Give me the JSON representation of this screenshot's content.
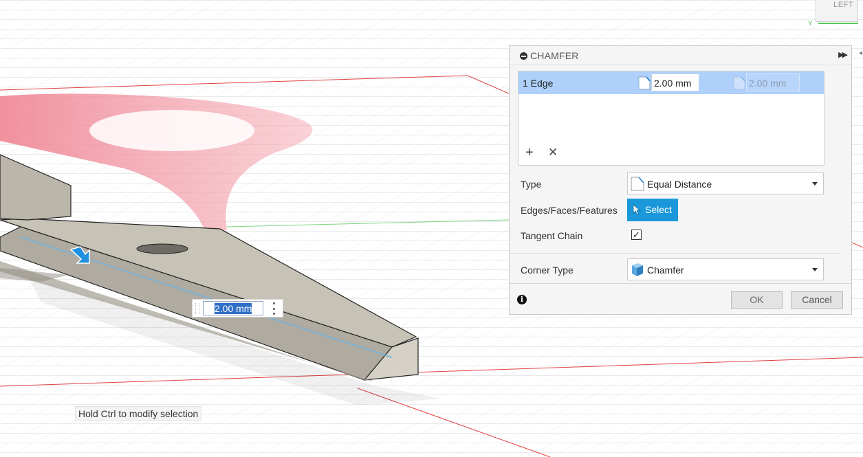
{
  "viewcube": {
    "face_label": "LEFT",
    "axis_label": "Y"
  },
  "canvas": {
    "floating_input_value": "2.00 mm",
    "hint": "Hold Ctrl to modify selection"
  },
  "dialog": {
    "title": "CHAMFER",
    "edge_row": {
      "label": "1 Edge",
      "distance1": "2.00 mm",
      "distance2": "2.00 mm"
    },
    "type": {
      "label": "Type",
      "value": "Equal Distance"
    },
    "edges": {
      "label": "Edges/Faces/Features",
      "button": "Select"
    },
    "tangent_chain": {
      "label": "Tangent Chain",
      "checked": true,
      "mark": "✓"
    },
    "corner_type": {
      "label": "Corner Type",
      "value": "Chamfer"
    },
    "ok_label": "OK",
    "cancel_label": "Cancel",
    "icons": {
      "collapse": "minus-circle-icon",
      "expand": "double-chevron-right-icon",
      "add": "plus-icon",
      "remove": "x-icon",
      "info": "info-icon",
      "cursor": "pointer-cursor-icon"
    }
  },
  "colors": {
    "selection_blue": "#aed0fb",
    "select_button": "#1b98d9",
    "red_axis": "#e04040",
    "green_axis": "#57c85a",
    "ghost_body": "#f08d99",
    "part_body": "#c9c4b9"
  }
}
